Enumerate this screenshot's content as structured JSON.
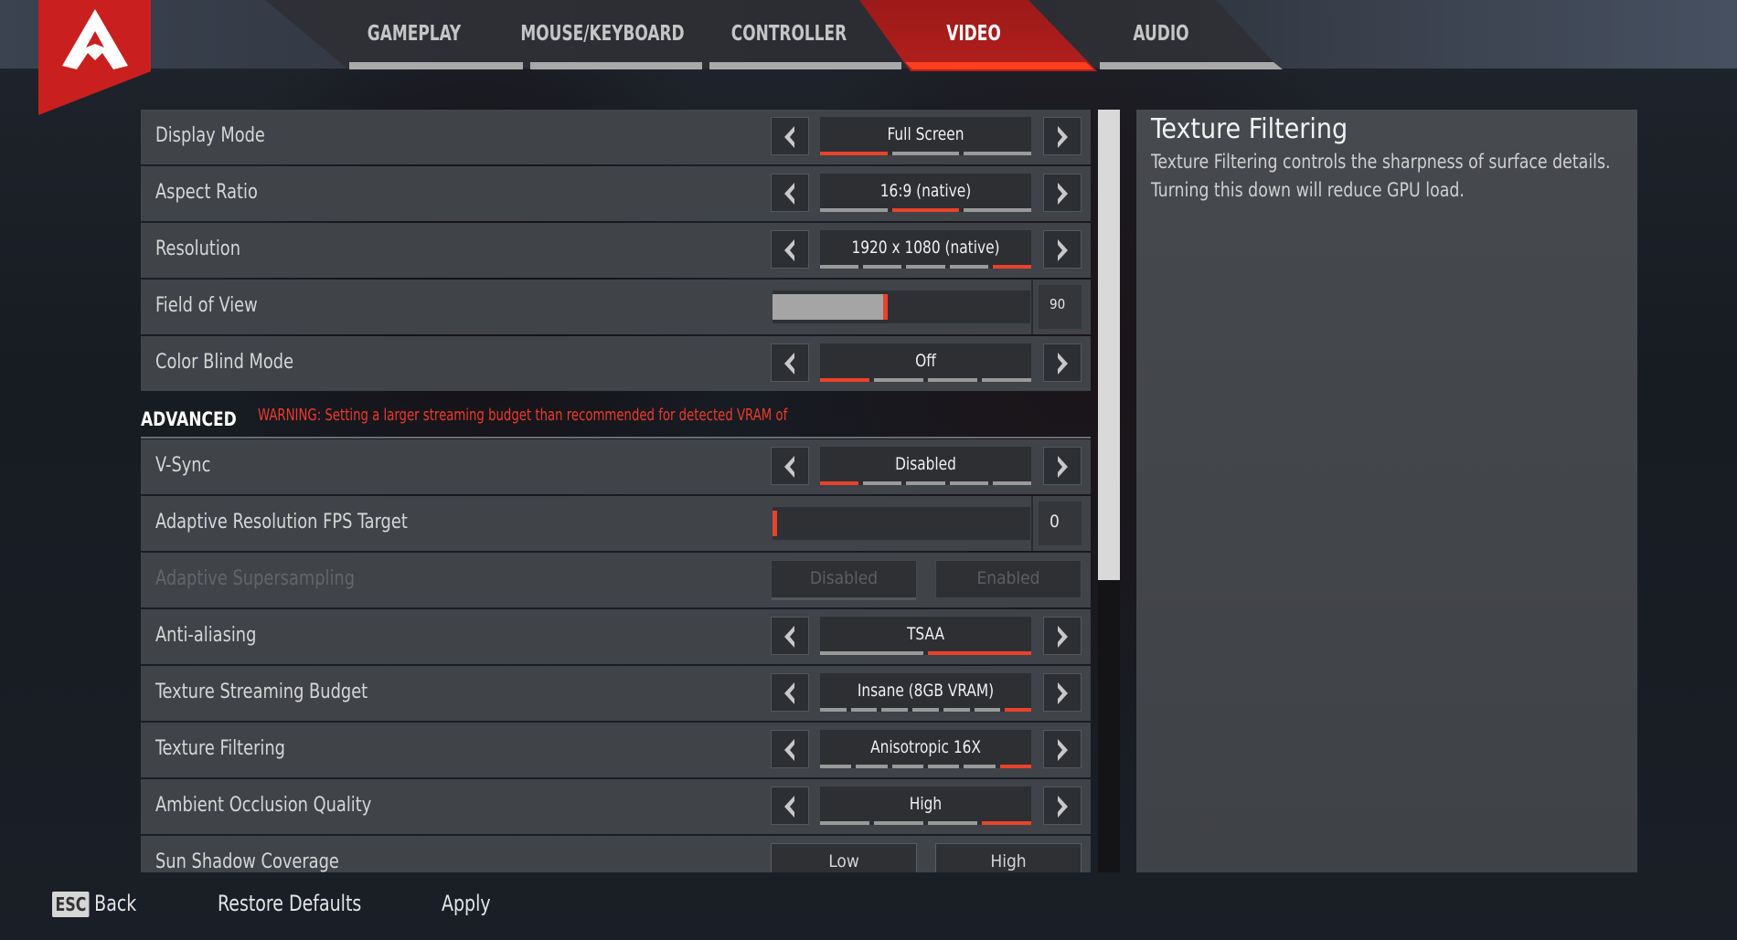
{
  "tabs": [
    {
      "label": "GAMEPLAY",
      "active": false
    },
    {
      "label": "MOUSE/KEYBOARD",
      "active": false
    },
    {
      "label": "CONTROLLER",
      "active": false
    },
    {
      "label": "VIDEO",
      "active": true
    },
    {
      "label": "AUDIO",
      "active": false
    }
  ],
  "colors": {
    "accent": "#e8432a",
    "brand_red": "#c9201f",
    "warning": "#ee3a2a"
  },
  "settings": [
    {
      "label": "Display Mode",
      "type": "selector",
      "value": "Full Screen",
      "options_count": 3,
      "selected_index": 0
    },
    {
      "label": "Aspect Ratio",
      "type": "selector",
      "value": "16:9 (native)",
      "options_count": 3,
      "selected_index": 1
    },
    {
      "label": "Resolution",
      "type": "selector",
      "value": "1920 x 1080 (native)",
      "options_count": 5,
      "selected_index": 4
    },
    {
      "label": "Field of View",
      "type": "slider",
      "value": "90",
      "fill_fraction": 0.5
    },
    {
      "label": "Color Blind Mode",
      "type": "selector",
      "value": "Off",
      "options_count": 4,
      "selected_index": 0
    }
  ],
  "advanced": {
    "title": "ADVANCED",
    "warning": "WARNING: Setting a larger streaming budget than recommended for detected VRAM of"
  },
  "advanced_settings": [
    {
      "label": "V-Sync",
      "type": "selector",
      "value": "Disabled",
      "options_count": 5,
      "selected_index": 0
    },
    {
      "label": "Adaptive Resolution FPS Target",
      "type": "slider",
      "value": "0",
      "fill_fraction": 0.0
    },
    {
      "label": "Adaptive Supersampling",
      "type": "toggle",
      "disabled": true,
      "options": [
        "Disabled",
        "Enabled"
      ],
      "selected_index": 0
    },
    {
      "label": "Anti-aliasing",
      "type": "selector",
      "value": "TSAA",
      "options_count": 2,
      "selected_index": 1
    },
    {
      "label": "Texture Streaming Budget",
      "type": "selector",
      "value": "Insane (8GB VRAM)",
      "options_count": 7,
      "selected_index": 6
    },
    {
      "label": "Texture Filtering",
      "type": "selector",
      "value": "Anisotropic 16X",
      "options_count": 6,
      "selected_index": 5
    },
    {
      "label": "Ambient Occlusion Quality",
      "type": "selector",
      "value": "High",
      "options_count": 4,
      "selected_index": 3
    },
    {
      "label": "Sun Shadow Coverage",
      "type": "toggle",
      "disabled": false,
      "options": [
        "Low",
        "High"
      ],
      "selected_index": 1
    }
  ],
  "description": {
    "title": "Texture Filtering",
    "body": "Texture Filtering controls the sharpness of surface details. Turning this down will reduce GPU load."
  },
  "footer": {
    "esc_key": "ESC",
    "back": "Back",
    "restore_defaults": "Restore Defaults",
    "apply": "Apply"
  }
}
